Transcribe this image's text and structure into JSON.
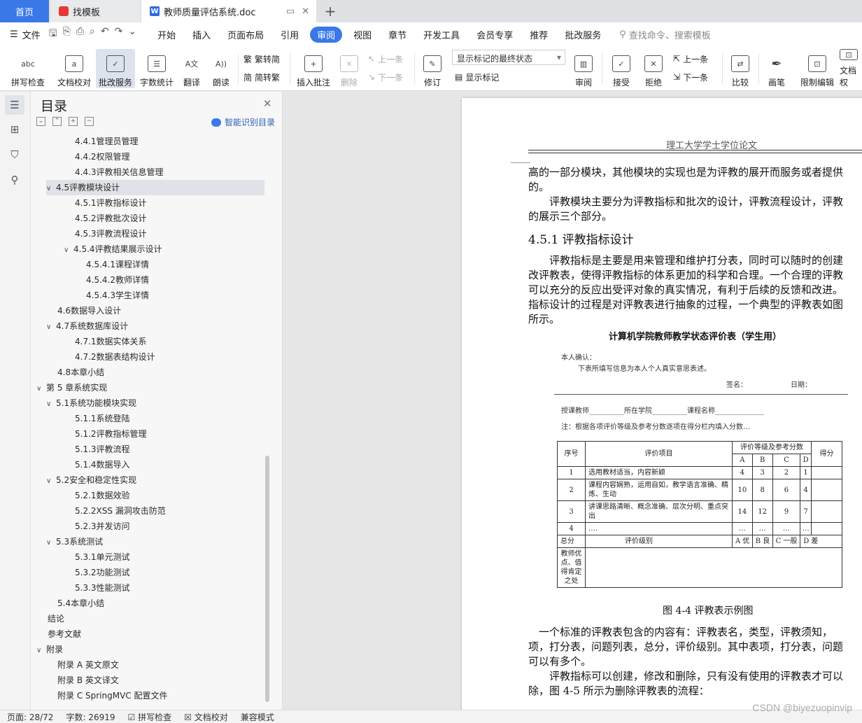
{
  "tabs": {
    "home": "首页",
    "find": "找模板",
    "doc": "教师质量评估系统.doc",
    "new_tab": "+"
  },
  "menu": {
    "file": "文件",
    "items": [
      "开始",
      "插入",
      "页面布局",
      "引用",
      "审阅",
      "视图",
      "章节",
      "开发工具",
      "会员专享",
      "推荐",
      "批改服务"
    ],
    "active": "审阅",
    "search": "查找命令、搜索模板"
  },
  "ribbon": {
    "spellcheck": "拼写检查",
    "doc_proof": "文档校对",
    "correction_service": "批改服务",
    "word_count": "字数统计",
    "translate": "翻译",
    "read_aloud": "朗读",
    "trad": "繁转简",
    "simp": "简转繁",
    "insert_comment": "插入批注",
    "delete": "删除",
    "prev": "上一条",
    "next": "下一条",
    "track": "修订",
    "display_state": "显示标记的最终状态",
    "show_marks": "显示标记",
    "review": "审阅",
    "accept": "接受",
    "reject": "拒绝",
    "prev2": "上一条",
    "next2": "下一条",
    "compare": "比较",
    "ink": "画笔",
    "restrict": "限制编辑",
    "doc_perm": "文档权"
  },
  "toc": {
    "title": "目录",
    "smart": "智能识别目录",
    "items": [
      {
        "label": "4.4.1管理员管理",
        "level": 3
      },
      {
        "label": "4.4.2权限管理",
        "level": 3
      },
      {
        "label": "4.4.3评教相关信息管理",
        "level": 3
      },
      {
        "label": "4.5评教模块设计",
        "level": 2,
        "caret": true,
        "selected": true
      },
      {
        "label": "4.5.1评教指标设计",
        "level": 3
      },
      {
        "label": "4.5.2评教批次设计",
        "level": 3
      },
      {
        "label": "4.5.3评教流程设计",
        "level": 3
      },
      {
        "label": "4.5.4评教结果展示设计",
        "level": 3,
        "caret": true
      },
      {
        "label": "4.5.4.1课程详情",
        "level": 4
      },
      {
        "label": "4.5.4.2教师详情",
        "level": 4
      },
      {
        "label": "4.5.4.3学生详情",
        "level": 4
      },
      {
        "label": "4.6数据导入设计",
        "level": 2
      },
      {
        "label": "4.7系统数据库设计",
        "level": 2,
        "caret": true
      },
      {
        "label": "4.7.1数据实体关系",
        "level": 3
      },
      {
        "label": "4.7.2数据表结构设计",
        "level": 3
      },
      {
        "label": "4.8本章小结",
        "level": 2
      },
      {
        "label": "第 5 章系统实现",
        "level": 1,
        "caret": true
      },
      {
        "label": "5.1系统功能模块实现",
        "level": 2,
        "caret": true
      },
      {
        "label": "5.1.1系统登陆",
        "level": 3
      },
      {
        "label": "5.1.2评教指标管理",
        "level": 3
      },
      {
        "label": "5.1.3评教流程",
        "level": 3
      },
      {
        "label": "5.1.4数据导入",
        "level": 3
      },
      {
        "label": "5.2安全和稳定性实现",
        "level": 2,
        "caret": true
      },
      {
        "label": "5.2.1数据效验",
        "level": 3
      },
      {
        "label": "5.2.2XSS 漏洞攻击防范",
        "level": 3
      },
      {
        "label": "5.2.3并发访问",
        "level": 3
      },
      {
        "label": "5.3系统测试",
        "level": 2,
        "caret": true
      },
      {
        "label": "5.3.1单元测试",
        "level": 3
      },
      {
        "label": "5.3.2功能测试",
        "level": 3
      },
      {
        "label": "5.3.3性能测试",
        "level": 3
      },
      {
        "label": "5.4本章小结",
        "level": 2
      },
      {
        "label": "结论",
        "level": 1
      },
      {
        "label": "参考文献",
        "level": 1
      },
      {
        "label": "附录",
        "level": 1,
        "caret": true
      },
      {
        "label": "附录 A  英文原文",
        "level": 2
      },
      {
        "label": "附录 B  英文译文",
        "level": 2
      },
      {
        "label": "附录 C SpringMVC 配置文件",
        "level": 2
      }
    ]
  },
  "page": {
    "header": "理工大学学士学位论文",
    "lines_top": [
      "高的一部分模块，其他模块的实现也是为评教的展开而服务或者提供",
      "的。",
      "　　评教模块主要分为评教指标和批次的设计，评教流程设计，评教",
      "的展示三个部分。"
    ],
    "heading": "4.5.1  评教指标设计",
    "lines_mid": [
      "　　评教指标是主要是用来管理和维护打分表，同时可以随时的创建",
      "改评教表，使得评教指标的体系更加的科学和合理。一个合理的评教",
      "可以充分的反应出受评对象的真实情况，有利于后续的反馈和改进。",
      "指标设计的过程是对评教表进行抽象的过程，一个典型的评教表如图",
      "所示。"
    ],
    "figure": {
      "title": "计算机学院教师教学状态评价表（学生用）",
      "confirm": "本人确认：",
      "confirm_text": "下表所填写信息为本人个人真实意思表述。",
      "sign": "签名：",
      "date": "日期：",
      "fields": "授课教师__________所在学院__________课程名称______________",
      "note": "注：根据各项评价等级及参考分数逐项在得分栏内填入分数…",
      "h_no": "序号",
      "h_item": "评价项目",
      "h_grade": "评价等级及参考分数",
      "h_score": "得分",
      "grades": [
        "A",
        "B",
        "C",
        "D"
      ],
      "rows": [
        {
          "no": "1",
          "item": "选用教材适当，内容新颖",
          "vals": [
            "4",
            "3",
            "2",
            "1"
          ]
        },
        {
          "no": "2",
          "item": "课程内容娴熟，运用自如，教学语言准确、精炼、生动",
          "vals": [
            "10",
            "8",
            "6",
            "4"
          ]
        },
        {
          "no": "3",
          "item": "讲课思路清晰、概念准确、层次分明、重点突出",
          "vals": [
            "14",
            "12",
            "9",
            "7"
          ]
        },
        {
          "no": "4",
          "item": "….",
          "vals": [
            "…",
            "…",
            "…",
            "…"
          ]
        }
      ],
      "total": "总分",
      "level": "评价级别",
      "levels": [
        "A 优",
        "B 良",
        "C 一般",
        "D 差"
      ],
      "merit": "教师优点、值得肯定之处",
      "caption": "图 4-4  评教表示例图"
    },
    "lines_bottom": [
      "　一个标准的评教表包含的内容有：评教表名，类型，评教须知，",
      "项，打分表，问题列表，总分，评价级别。其中表项，打分表，问题",
      "可以有多个。",
      "　　评教指标可以创建，修改和删除，只有没有使用的评教表才可以",
      "除，图 4-5 所示为删除评教表的流程："
    ]
  },
  "status": {
    "page": "页面: 28/72",
    "words": "字数: 26919",
    "spell": "拼写检查",
    "proof": "文档校对",
    "compat": "兼容模式"
  },
  "watermark": "CSDN @biyezuopinvip"
}
